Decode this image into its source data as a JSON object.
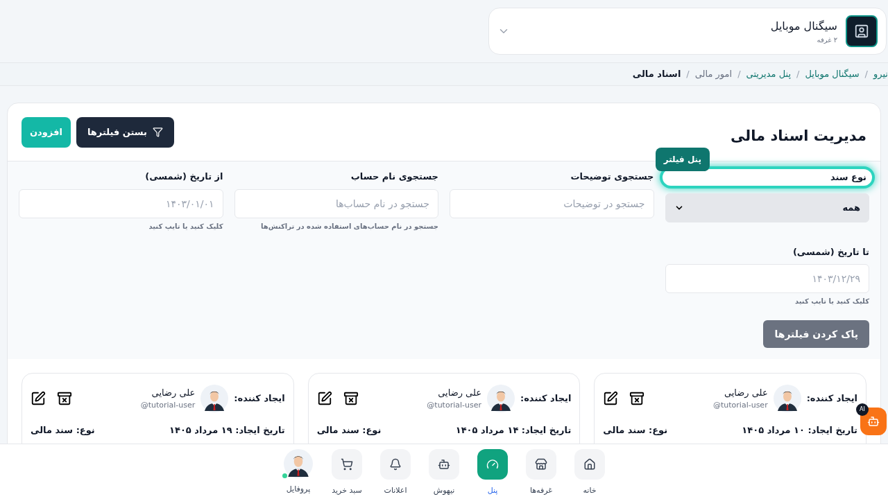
{
  "store": {
    "name": "سیگنال موبایل",
    "subtitle": "۲ غرفه"
  },
  "breadcrumb_separator": "/",
  "breadcrumb": [
    {
      "label": "نیرو",
      "kind": "link"
    },
    {
      "label": "سیگنال موبایل",
      "kind": "link"
    },
    {
      "label": "پنل مدیریتی",
      "kind": "link"
    },
    {
      "label": "امور مالی",
      "kind": "muted"
    },
    {
      "label": "اسناد مالی",
      "kind": "current"
    }
  ],
  "page": {
    "title": "مدیریت اسناد مالی",
    "close_filters": "بستن فیلترها",
    "add": "افزودن"
  },
  "tutorial": {
    "tooltip": "پنل فیلتر"
  },
  "filters": [
    {
      "kind": "select",
      "label": "نوع سند",
      "value": "همه",
      "highlighted": true
    },
    {
      "kind": "text",
      "label": "جستجوی توضیحات",
      "placeholder": "جستجو در توضیحات",
      "highlighted": false
    },
    {
      "kind": "text",
      "label": "جستجوی نام حساب",
      "placeholder": "جستجو در نام حساب‌ها",
      "hint": "جستجو در نام حساب‌های استفاده شده در تراکنش‌ها",
      "highlighted": false
    },
    {
      "kind": "text",
      "label": "از تاریخ (شمسی)",
      "placeholder": "۱۴۰۳/۰۱/۰۱",
      "hint": "کلیک کنید یا تایپ کنید",
      "highlighted": false
    },
    {
      "kind": "text",
      "label": "تا تاریخ (شمسی)",
      "placeholder": "۱۴۰۳/۱۲/۲۹",
      "hint": "کلیک کنید یا تایپ کنید",
      "highlighted": false
    }
  ],
  "clear_filters": "پاک کردن فیلترها",
  "cards": [
    {
      "creator_label": "ایجاد کننده:",
      "name": "علی رضایی",
      "handle": "tutorial-user@",
      "date": "تاریخ ایجاد: ۱۰ مرداد ۱۴۰۵",
      "type": "نوع: سند مالی"
    },
    {
      "creator_label": "ایجاد کننده:",
      "name": "علی رضایی",
      "handle": "tutorial-user@",
      "date": "تاریخ ایجاد: ۱۴ مرداد ۱۴۰۵",
      "type": "نوع: سند مالی"
    },
    {
      "creator_label": "ایجاد کننده:",
      "name": "علی رضایی",
      "handle": "tutorial-user@",
      "date": "تاریخ ایجاد: ۱۹ مرداد ۱۴۰۵",
      "type": "نوع: سند مالی"
    }
  ],
  "ai_badge": "AI",
  "nav": [
    {
      "kind": "home",
      "label": "خانه",
      "selected": false
    },
    {
      "kind": "store",
      "label": "غرفه‌ها",
      "selected": false
    },
    {
      "kind": "panel",
      "label": "پنل",
      "selected": true
    },
    {
      "kind": "bot",
      "label": "نیهوش",
      "selected": false
    },
    {
      "kind": "bell",
      "label": "اعلانات",
      "selected": false
    },
    {
      "kind": "cart",
      "label": "سبد خرید",
      "selected": false
    },
    {
      "kind": "profile",
      "label": "پروفایل",
      "selected": false,
      "online": true
    }
  ]
}
